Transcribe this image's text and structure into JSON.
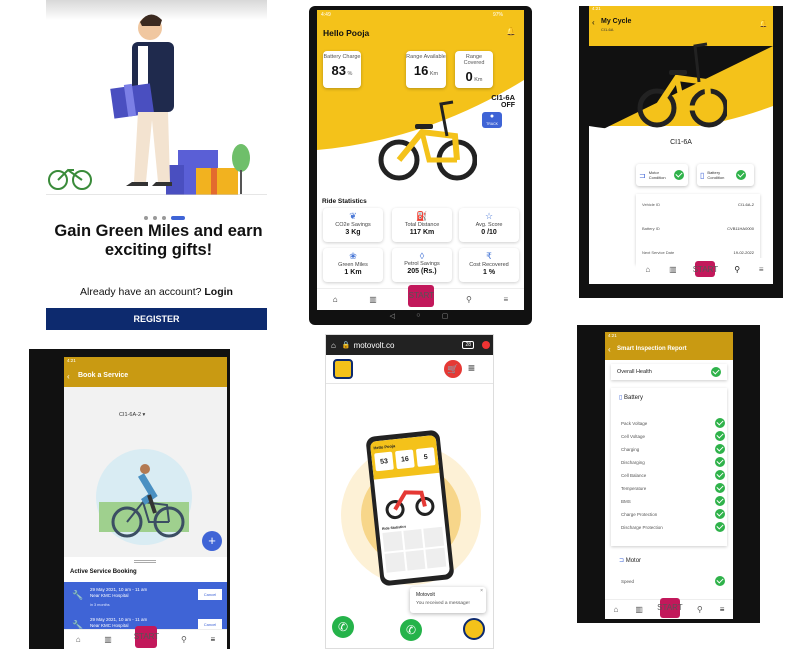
{
  "s1": {
    "headline": "Gain Green Miles and earn exciting gifts!",
    "account_prompt": "Already have an account?",
    "login": "Login",
    "register": "REGISTER"
  },
  "s2": {
    "time": "4:49",
    "battery_status": "97%",
    "greeting": "Hello Pooja",
    "cards": [
      {
        "label": "Battery Charge",
        "value": "83",
        "unit": "%"
      },
      {
        "label": "Range Available",
        "value": "16",
        "unit": "Km"
      },
      {
        "label": "Range Covered",
        "value": "0",
        "unit": "Km"
      }
    ],
    "cycle_id": "CI1-6A",
    "cycle_status": "OFF",
    "track": "TRACK",
    "stats_title": "Ride Statistics",
    "stats": [
      {
        "label": "CO2e Savings",
        "value": "3",
        "unit": "Kg"
      },
      {
        "label": "Total Distance",
        "value": "117",
        "unit": "Km"
      },
      {
        "label": "Avg. Score",
        "value": "0",
        "unit": "/10"
      },
      {
        "label": "Green Miles",
        "value": "1",
        "unit": "Km"
      },
      {
        "label": "Petrol Savings",
        "value": "205",
        "unit": "(Rs.)"
      },
      {
        "label": "Cost Recovered",
        "value": "1",
        "unit": "%"
      }
    ],
    "start": "START"
  },
  "s3": {
    "time": "4:21",
    "title": "My Cycle",
    "subtitle": "CI1-6A",
    "cycle_id": "CI1-6A",
    "motor": "Motor Condition",
    "battery": "Battery Condition",
    "rows": [
      {
        "k": "Vehicle ID",
        "v": "CI1-6A-2"
      },
      {
        "k": "Battery ID",
        "v": "CVB11HA0000"
      },
      {
        "k": "Next Service Date",
        "v": "19-02-2022"
      }
    ],
    "start": "START"
  },
  "s4": {
    "time": "4:21",
    "title": "Book a Service",
    "vehicle": "CI1-6A-2",
    "section": "Active Service Booking",
    "bookings": [
      {
        "date": "29 May 2021, 10 am - 11 am",
        "place": "Near KMC Hospital",
        "when": "in 3 months",
        "action": "Cancel"
      },
      {
        "date": "29 May 2021, 10 am - 11 am",
        "place": "Near KMC Hospital",
        "action": "Cancel"
      }
    ],
    "start": "START"
  },
  "s5": {
    "url": "motovolt.co",
    "tabs": "28",
    "phone": {
      "greeting": "Hello Pooja",
      "v1": "53",
      "v2": "16",
      "v3": "5",
      "stats_title": "Ride Statistics"
    },
    "chat_name": "Motovolt",
    "chat_msg": "You received a message!"
  },
  "s6": {
    "time": "4:21",
    "title": "Smart Inspection Report",
    "overall": "Overall Health",
    "battery": "Battery",
    "battery_rows": [
      "Pack Voltage",
      "Cell Voltage",
      "Charging",
      "Discharging",
      "Cell Balance",
      "Temperature",
      "BMS",
      "Charge Protection",
      "Discharge Protection"
    ],
    "motor": "Motor",
    "motor_rows": [
      "Speed"
    ],
    "start": "START"
  },
  "colors": {
    "yellow": "#f4c21a",
    "navy": "#0d2a6e",
    "blue": "#3f64d6",
    "magenta": "#c2185b",
    "green": "#2fb24a"
  }
}
